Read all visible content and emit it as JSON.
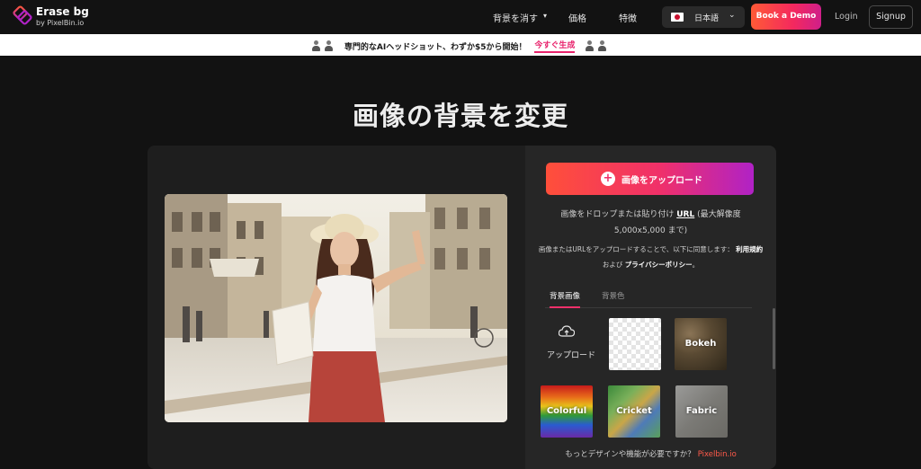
{
  "nav": {
    "logo_name": "Erase bg",
    "logo_sub": "by PixelBin.io",
    "items": [
      {
        "label": "背景を消す"
      },
      {
        "label": "価格"
      },
      {
        "label": "特徴"
      }
    ],
    "language": "日本語",
    "demo_label": "Book a Demo",
    "login_label": "Login",
    "signup_label": "Signup"
  },
  "promo": {
    "text": "専門的なAIヘッドショット、わずか$5から開始！",
    "cta": "今すぐ生成"
  },
  "hero": {
    "title": "画像の背景を変更"
  },
  "uploader": {
    "button_label": "画像をアップロード",
    "drop_prefix": "画像をドロップまたは貼り付け",
    "drop_url": "URL",
    "drop_suffix": "(最大解像度 5,000x5,000 まで)",
    "terms_prefix": "画像またはURLをアップロードすることで、以下に同意します：",
    "terms_link": "利用規約",
    "terms_and": "および",
    "privacy_link": "プライバシーポリシー",
    "terms_end": "。"
  },
  "tabs": {
    "active": "背景画像",
    "inactive": "背景色"
  },
  "backgrounds": {
    "upload_label": "アップロード",
    "tiles": [
      "Bokeh",
      "Colorful",
      "Cricket",
      "Fabric"
    ]
  },
  "footer": {
    "more_text": "もっとデザインや機能が必要ですか？",
    "more_link": "Pixelbin.io"
  },
  "colors": {
    "accent": "#f0306a",
    "background": "#121212",
    "card": "#1e1e1e",
    "panel": "#262626"
  }
}
